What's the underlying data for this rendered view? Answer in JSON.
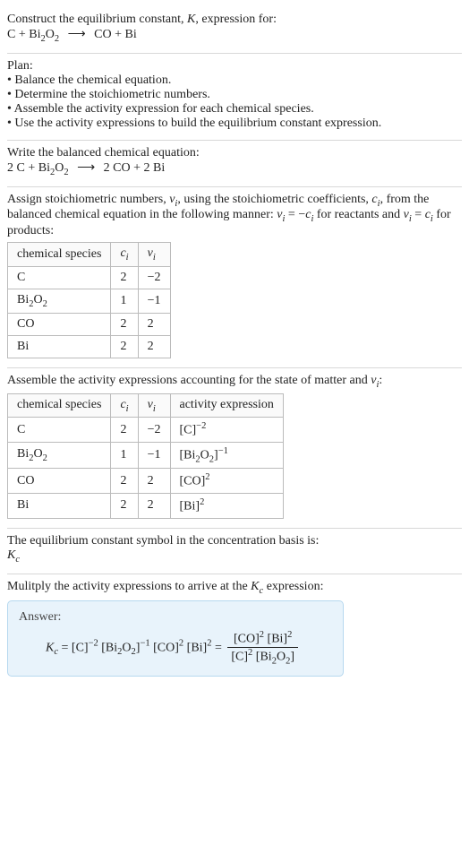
{
  "intro": {
    "line1": "Construct the equilibrium constant, ",
    "K": "K",
    "line1b": ", expression for:",
    "eq_unbalanced_lhs1": "C + Bi",
    "eq_unbalanced_lhs2": "O",
    "eq_unbalanced_rhs": "CO + Bi",
    "arrow": "⟶"
  },
  "plan": {
    "heading": "Plan:",
    "b1": "• Balance the chemical equation.",
    "b2": "• Determine the stoichiometric numbers.",
    "b3": "• Assemble the activity expression for each chemical species.",
    "b4": "• Use the activity expressions to build the equilibrium constant expression."
  },
  "balanced": {
    "heading": "Write the balanced chemical equation:",
    "lhs_a": "2 C + Bi",
    "lhs_b": "O",
    "arrow": "⟶",
    "rhs": "2 CO + 2 Bi"
  },
  "stoich": {
    "text_a": "Assign stoichiometric numbers, ",
    "nu": "ν",
    "sub_i": "i",
    "text_b": ", using the stoichiometric coefficients, ",
    "c": "c",
    "text_c": ", from the balanced chemical equation in the following manner: ",
    "rule_react": " = −",
    "text_d": " for reactants and ",
    "rule_prod": " = ",
    "text_e": " for products:",
    "headers": {
      "h1": "chemical species",
      "h2": "cᵢ",
      "h3": "νᵢ"
    },
    "rows": [
      {
        "sp": "C",
        "ci": "2",
        "vi": "−2"
      },
      {
        "sp": "Bi2O2",
        "ci": "1",
        "vi": "−1"
      },
      {
        "sp": "CO",
        "ci": "2",
        "vi": "2"
      },
      {
        "sp": "Bi",
        "ci": "2",
        "vi": "2"
      }
    ]
  },
  "activity": {
    "heading_a": "Assemble the activity expressions accounting for the state of matter and ",
    "heading_b": ":",
    "headers": {
      "h1": "chemical species",
      "h2": "cᵢ",
      "h3": "νᵢ",
      "h4": "activity expression"
    },
    "rows": [
      {
        "sp": "C",
        "ci": "2",
        "vi": "−2",
        "ae_base": "[C]",
        "ae_exp": "−2"
      },
      {
        "sp": "Bi2O2",
        "ci": "1",
        "vi": "−1",
        "ae_base": "[Bi2O2]",
        "ae_exp": "−1"
      },
      {
        "sp": "CO",
        "ci": "2",
        "vi": "2",
        "ae_base": "[CO]",
        "ae_exp": "2"
      },
      {
        "sp": "Bi",
        "ci": "2",
        "vi": "2",
        "ae_base": "[Bi]",
        "ae_exp": "2"
      }
    ]
  },
  "symbol": {
    "text": "The equilibrium constant symbol in the concentration basis is:",
    "K": "K",
    "c": "c"
  },
  "final": {
    "heading": "Mulitply the activity expressions to arrive at the ",
    "heading_b": " expression:",
    "answer": "Answer:",
    "Kc": "K",
    "c": "c",
    "eq": " = ",
    "t1": "[C]",
    "e1": "−2",
    "t2": " [Bi",
    "t2b": "O",
    "t2c": "]",
    "e2": "−1",
    "t3": " [CO]",
    "e3": "2",
    "t4": " [Bi]",
    "e4": "2",
    "num_a": "[CO]",
    "num_a_e": "2",
    "num_b": " [Bi]",
    "num_b_e": "2",
    "den_a": "[C]",
    "den_a_e": "2",
    "den_b": " [Bi",
    "den_b2": "O",
    "den_b3": "]"
  }
}
